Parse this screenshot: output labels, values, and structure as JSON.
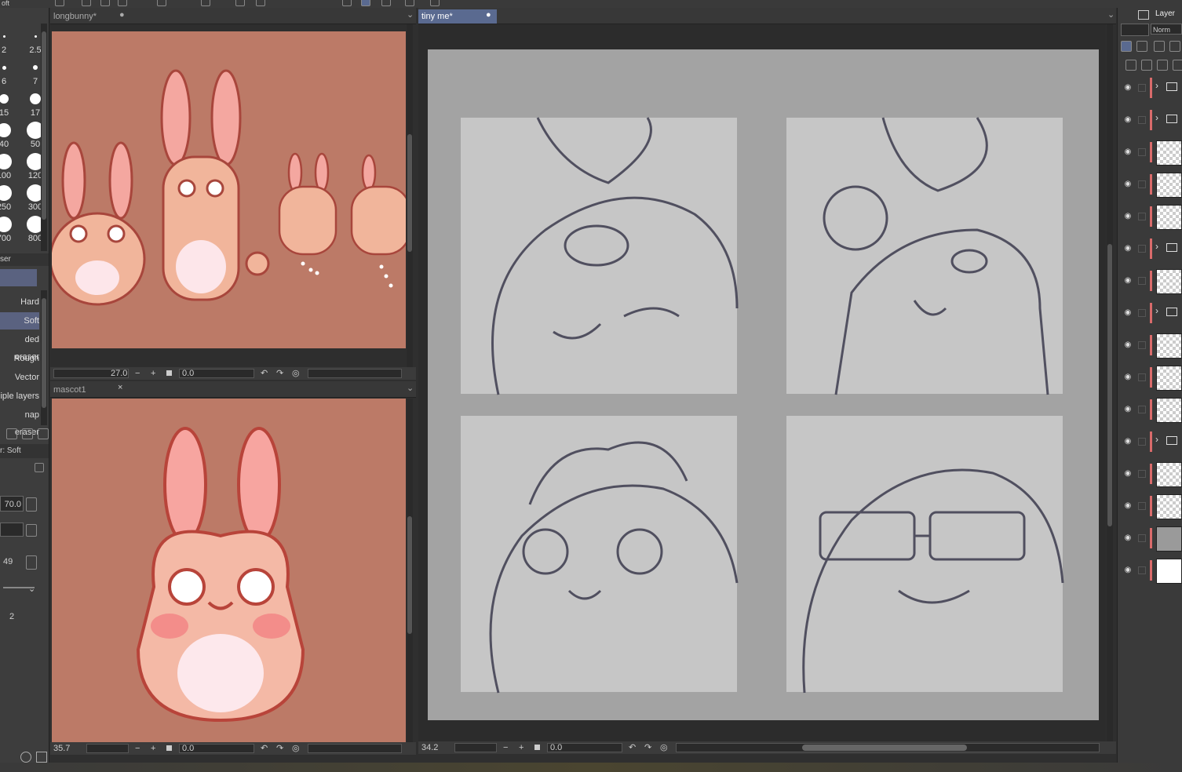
{
  "window": {
    "title_partial": "oft"
  },
  "brush_sizes": [
    {
      "label": "2",
      "d": 3
    },
    {
      "label": "2.5",
      "d": 3
    },
    {
      "label": "6",
      "d": 5
    },
    {
      "label": "7",
      "d": 6
    },
    {
      "label": "15",
      "d": 12
    },
    {
      "label": "17",
      "d": 14
    },
    {
      "label": "40",
      "d": 18
    },
    {
      "label": "50",
      "d": 22
    },
    {
      "label": "100",
      "d": 20
    },
    {
      "label": "120",
      "d": 22
    },
    {
      "label": "250",
      "d": 20
    },
    {
      "label": "300",
      "d": 22
    },
    {
      "label": "700",
      "d": 20
    },
    {
      "label": "800",
      "d": 22
    }
  ],
  "eraser_panel": {
    "header": "ser",
    "items": [
      "Hard",
      "Soft",
      "ded eraser",
      "Rough",
      "Vector",
      "iple layers",
      "nap eraser"
    ],
    "selected": "Soft"
  },
  "tool_property": {
    "title": "r: Soft",
    "size_value": "70.0",
    "hardness_value": "49",
    "density_value": "2"
  },
  "windows": {
    "longbunny": {
      "tab": "longbunny*",
      "zoom": "27.0",
      "angle": "0.0"
    },
    "mascot1": {
      "tab": "mascot1",
      "zoom": "35.7",
      "angle": "0.0"
    },
    "tinyme": {
      "tab": "tiny me*",
      "zoom": "34.2",
      "angle": "0.0"
    }
  },
  "layer_panel": {
    "title": "Layer",
    "blend_mode": "Norm",
    "layers": [
      {
        "type": "folder"
      },
      {
        "type": "folder"
      },
      {
        "type": "raster"
      },
      {
        "type": "raster"
      },
      {
        "type": "raster"
      },
      {
        "type": "folder"
      },
      {
        "type": "raster"
      },
      {
        "type": "folder"
      },
      {
        "type": "raster"
      },
      {
        "type": "raster"
      },
      {
        "type": "raster"
      },
      {
        "type": "folder"
      },
      {
        "type": "raster"
      },
      {
        "type": "raster"
      },
      {
        "type": "gray"
      },
      {
        "type": "white"
      }
    ]
  },
  "colors": {
    "canvas_brown": "#bc7a67",
    "paper_gray": "#a3a3a3",
    "panel_gray": "#c6c6c6",
    "accent": "#5a6a90",
    "layer_mark": "#d96b6b"
  }
}
